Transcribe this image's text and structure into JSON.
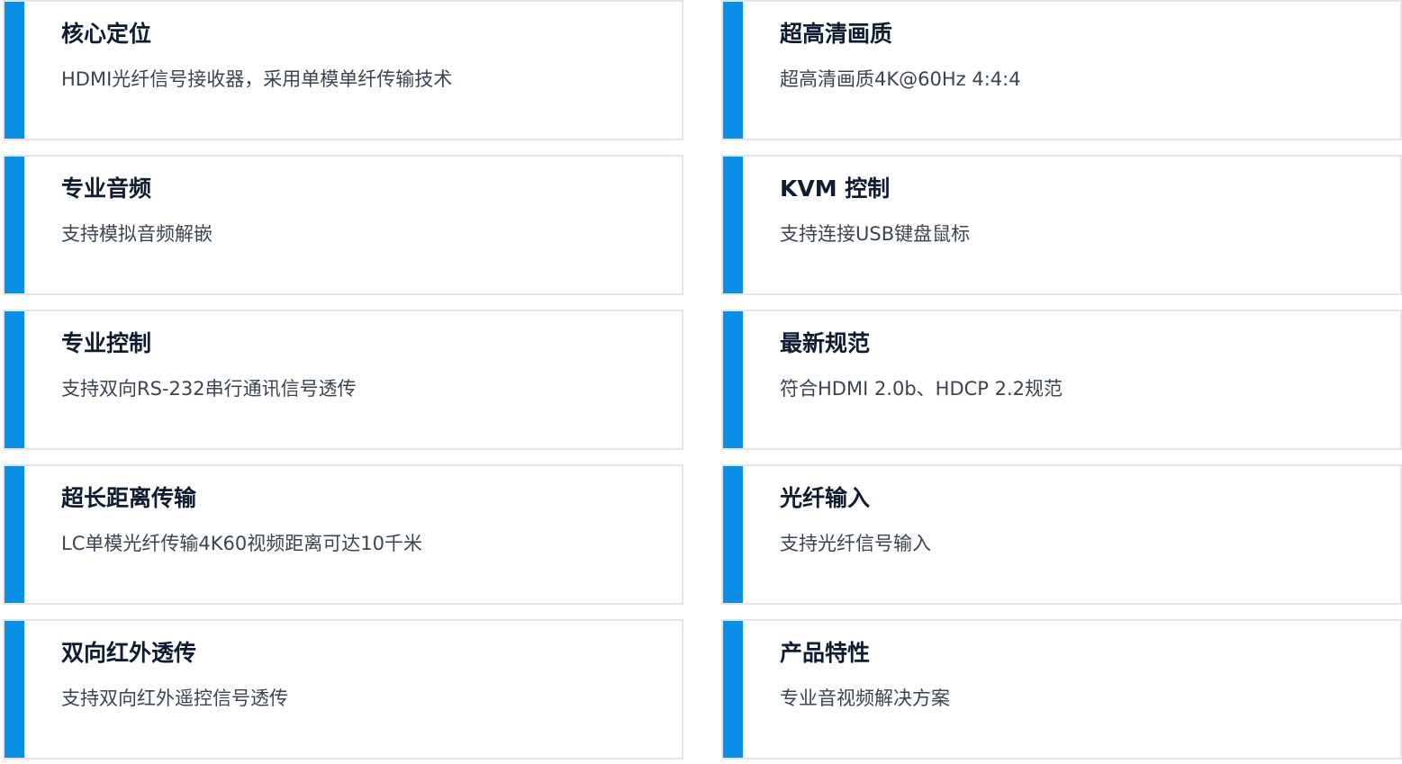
{
  "colors": {
    "accent": "#0a8fe6",
    "border": "#e2e6eb",
    "title": "#0f1d33",
    "text": "#3b4452"
  },
  "features": [
    {
      "title": "核心定位",
      "desc": "HDMI光纤信号接收器，采用单模单纤传输技术"
    },
    {
      "title": "超高清画质",
      "desc": "超高清画质4K@60Hz 4:4:4"
    },
    {
      "title": "专业音频",
      "desc": "支持模拟音频解嵌"
    },
    {
      "title": "KVM 控制",
      "desc": "支持连接USB键盘鼠标"
    },
    {
      "title": "专业控制",
      "desc": "支持双向RS-232串行通讯信号透传"
    },
    {
      "title": "最新规范",
      "desc": "符合HDMI 2.0b、HDCP 2.2规范"
    },
    {
      "title": "超长距离传输",
      "desc": "LC单模光纤传输4K60视频距离可达10千米"
    },
    {
      "title": "光纤输入",
      "desc": "支持光纤信号输入"
    },
    {
      "title": "双向红外透传",
      "desc": "支持双向红外遥控信号透传"
    },
    {
      "title": "产品特性",
      "desc": "专业音视频解决方案"
    }
  ]
}
